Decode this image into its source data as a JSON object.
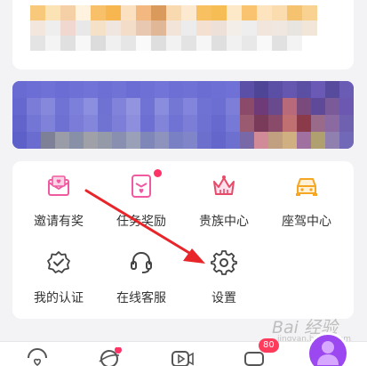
{
  "menu": {
    "items": [
      {
        "label": "邀请有奖",
        "icon": "invite-envelope-icon"
      },
      {
        "label": "任务奖励",
        "icon": "task-reward-icon",
        "has_dot": true
      },
      {
        "label": "贵族中心",
        "icon": "crown-icon"
      },
      {
        "label": "座驾中心",
        "icon": "car-icon"
      },
      {
        "label": "我的认证",
        "icon": "verified-badge-icon"
      },
      {
        "label": "在线客服",
        "icon": "headset-icon"
      },
      {
        "label": "设置",
        "icon": "gear-icon"
      }
    ]
  },
  "bottom_nav": {
    "badge_count": "80",
    "items": [
      "home-heart-icon",
      "planet-icon",
      "video-icon",
      "message-icon",
      "profile-icon"
    ]
  },
  "watermark": {
    "text": "Bai 经验",
    "sub": "jingyan.baidu.com"
  },
  "colors": {
    "pink": "#f05aa0",
    "red_dot": "#ff3366",
    "arrow": "#e8262a",
    "gold": "#f5a623",
    "banner": "#6e6fd4"
  }
}
